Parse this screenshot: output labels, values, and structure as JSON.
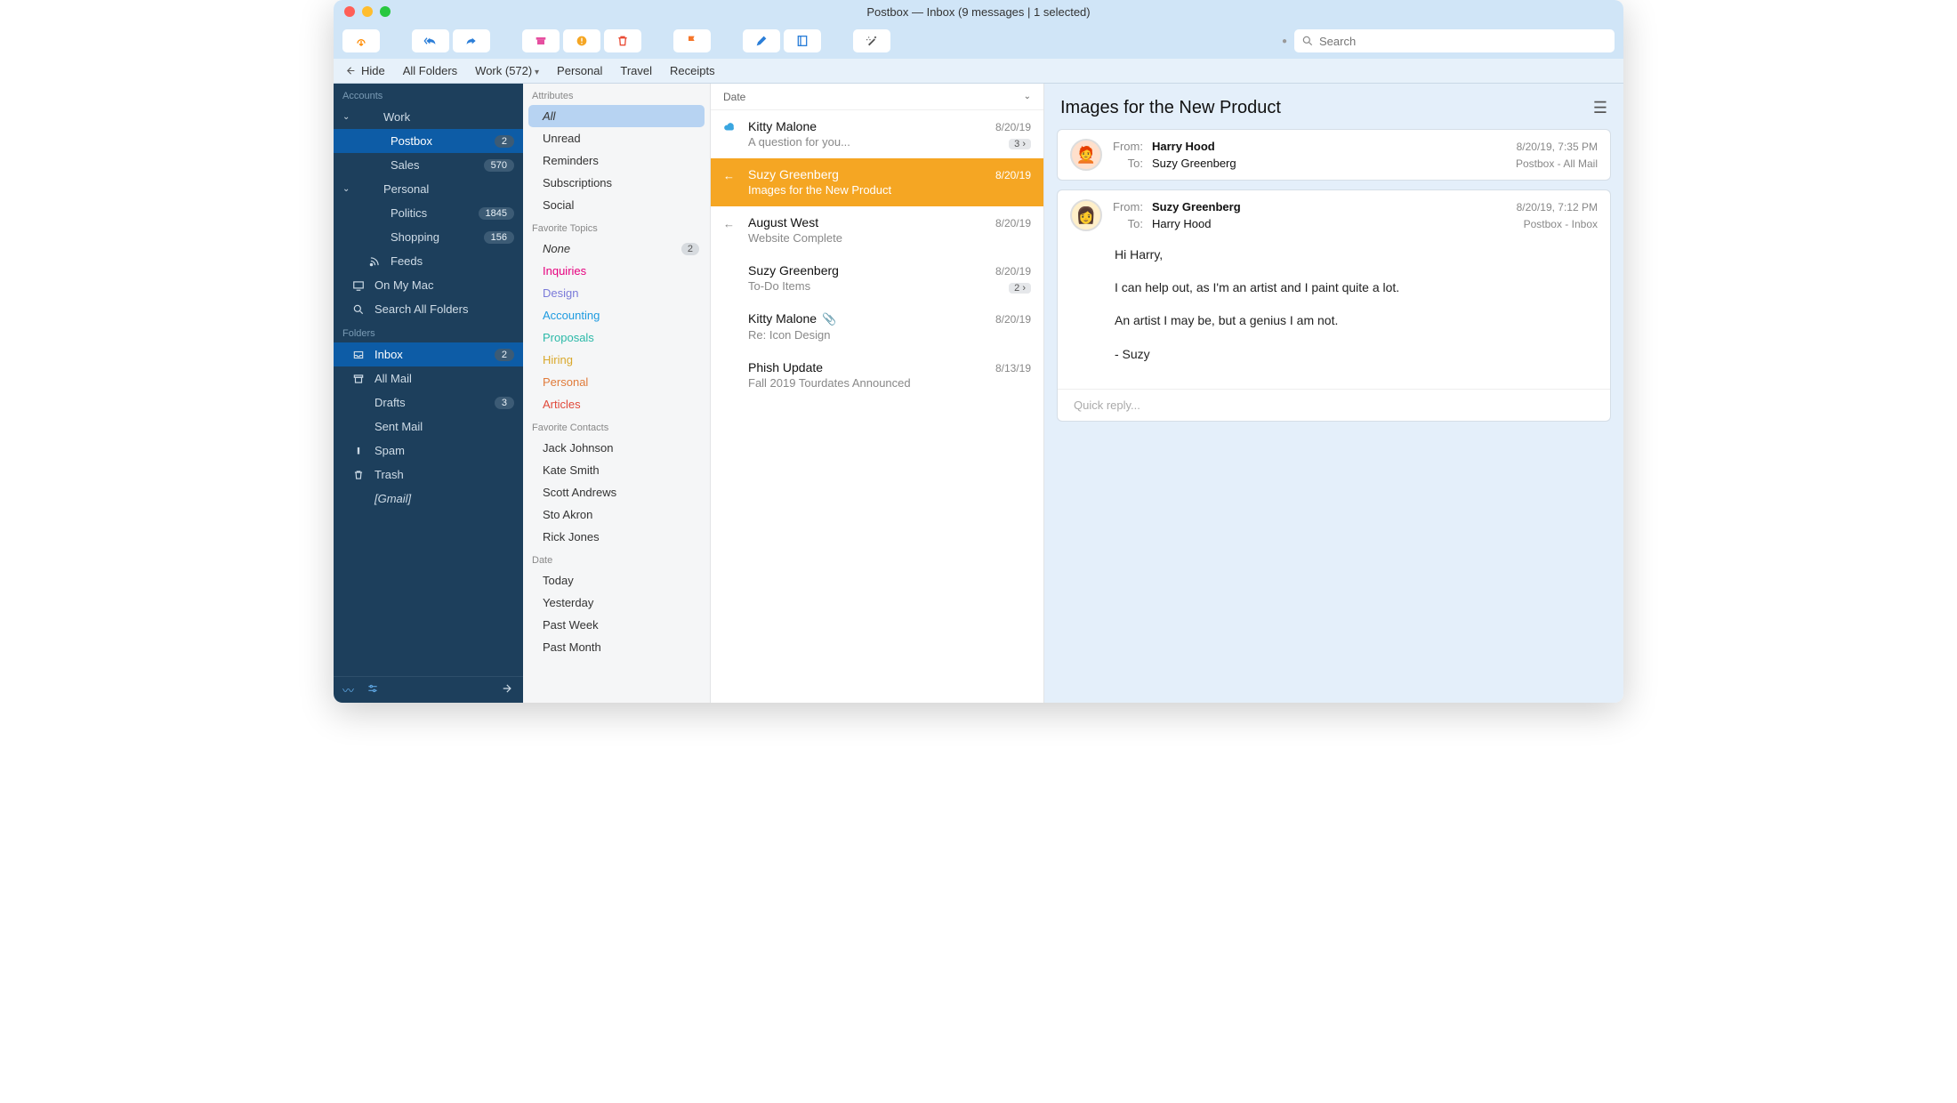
{
  "window_title": "Postbox — Inbox (9 messages | 1 selected)",
  "toolbar": {
    "search_placeholder": "Search"
  },
  "favbar": {
    "hide": "Hide",
    "items": [
      "All Folders",
      "Work (572)",
      "Personal",
      "Travel",
      "Receipts"
    ]
  },
  "sidebar": {
    "accounts_header": "Accounts",
    "accounts": [
      {
        "label": "Work",
        "type": "parent"
      },
      {
        "label": "Postbox",
        "type": "indent",
        "badge": "2",
        "selected": true
      },
      {
        "label": "Sales",
        "type": "indent",
        "badge": "570"
      },
      {
        "label": "Personal",
        "type": "parent"
      },
      {
        "label": "Politics",
        "type": "indent",
        "badge": "1845"
      },
      {
        "label": "Shopping",
        "type": "indent",
        "badge": "156"
      },
      {
        "label": "Feeds",
        "type": "indent",
        "icon": "rss"
      },
      {
        "label": "On My Mac",
        "type": "item",
        "icon": "monitor"
      },
      {
        "label": "Search All Folders",
        "type": "item",
        "icon": "search"
      }
    ],
    "folders_header": "Folders",
    "folders": [
      {
        "label": "Inbox",
        "icon": "inbox",
        "badge": "2",
        "selected": true
      },
      {
        "label": "All Mail",
        "icon": "archive"
      },
      {
        "label": "Drafts",
        "icon": "pencil",
        "badge": "3"
      },
      {
        "label": "Sent Mail",
        "icon": "send"
      },
      {
        "label": "Spam",
        "icon": "alert"
      },
      {
        "label": "Trash",
        "icon": "trash"
      },
      {
        "label": "[Gmail]",
        "icon": "folder",
        "italic": true
      }
    ]
  },
  "attributes": {
    "header1": "Attributes",
    "list1": [
      {
        "label": "All",
        "italic": true,
        "selected": true
      },
      {
        "label": "Unread"
      },
      {
        "label": "Reminders"
      },
      {
        "label": "Subscriptions"
      },
      {
        "label": "Social"
      }
    ],
    "header2": "Favorite Topics",
    "list2": [
      {
        "label": "None",
        "italic": true,
        "badge": "2",
        "color": "#333"
      },
      {
        "label": "Inquiries",
        "color": "#e6007e"
      },
      {
        "label": "Design",
        "color": "#7a7ad9"
      },
      {
        "label": "Accounting",
        "color": "#1e9be0"
      },
      {
        "label": "Proposals",
        "color": "#2bb9a8"
      },
      {
        "label": "Hiring",
        "color": "#d9a82b"
      },
      {
        "label": "Personal",
        "color": "#e07b3a"
      },
      {
        "label": "Articles",
        "color": "#e0493a"
      }
    ],
    "header3": "Favorite Contacts",
    "list3": [
      {
        "label": "Jack Johnson"
      },
      {
        "label": "Kate Smith"
      },
      {
        "label": "Scott Andrews"
      },
      {
        "label": "Sto Akron"
      },
      {
        "label": "Rick Jones"
      }
    ],
    "header4": "Date",
    "list4": [
      {
        "label": "Today"
      },
      {
        "label": "Yesterday"
      },
      {
        "label": "Past Week"
      },
      {
        "label": "Past Month"
      }
    ]
  },
  "messagelist": {
    "sort": "Date",
    "items": [
      {
        "from": "Kitty Malone",
        "subject": "A question for you...",
        "date": "8/20/19",
        "badge": "3 ›",
        "icon": "cloud"
      },
      {
        "from": "Suzy Greenberg",
        "subject": "Images for the New Product",
        "date": "8/20/19",
        "selected": true,
        "icon": "reply"
      },
      {
        "from": "August West",
        "subject": "Website Complete",
        "date": "8/20/19",
        "icon": "reply"
      },
      {
        "from": "Suzy Greenberg",
        "subject": "To-Do Items",
        "date": "8/20/19",
        "badge": "2 ›"
      },
      {
        "from": "Kitty Malone",
        "subject": "Re: Icon Design",
        "date": "8/20/19",
        "attachment": true
      },
      {
        "from": "Phish Update",
        "subject": "Fall 2019 Tourdates Announced",
        "date": "8/13/19"
      }
    ]
  },
  "reader": {
    "title": "Images for the New Product",
    "from_lbl": "From:",
    "to_lbl": "To:",
    "cards": [
      {
        "from": "Harry Hood",
        "to": "Suzy Greenberg",
        "date": "8/20/19, 7:35 PM",
        "folder": "Postbox - All Mail",
        "avatar_bg": "#ffe0cc",
        "avatar_emoji": "🧑‍🦰"
      },
      {
        "from": "Suzy Greenberg",
        "to": "Harry Hood",
        "date": "8/20/19, 7:12 PM",
        "folder": "Postbox - Inbox",
        "avatar_bg": "#ffefc9",
        "avatar_emoji": "👩",
        "body": [
          "Hi Harry,",
          "I can help out, as I'm an artist and I paint quite a lot.",
          "An artist I may be, but a genius I am not.",
          "- Suzy"
        ],
        "quick_reply": "Quick reply..."
      }
    ]
  }
}
